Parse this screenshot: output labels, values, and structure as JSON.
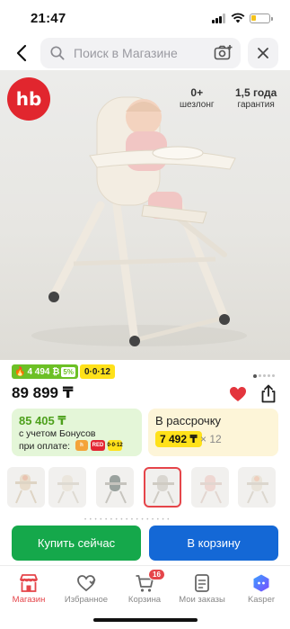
{
  "status_bar": {
    "time": "21:47"
  },
  "search": {
    "placeholder": "Поиск в Магазине"
  },
  "product": {
    "brand_logo": "hb",
    "age_from": "0+",
    "age_from_label": "шезлонг",
    "age_to": "1,5 года",
    "age_to_label": "гарантия",
    "bonus_badge": "4 494 ₿",
    "bonus_badge_pct": "5%",
    "installment_badge": "0·0·12",
    "price": "89 899 ₸",
    "image_count": 5,
    "current_image": 1
  },
  "bonus_card": {
    "amount": "85 405 ₸",
    "line1": "с учетом Бонусов",
    "line2": "при оплате:",
    "icons": [
      "h",
      "RED",
      "0·0·12"
    ]
  },
  "installment_card": {
    "title": "В рассрочку",
    "monthly": "7 492 ₸",
    "multiplier": "× 12"
  },
  "thumbnails": {
    "count": 6,
    "selected_index": 3
  },
  "actions": {
    "buy_now": "Купить сейчас",
    "add_to_cart": "В корзину"
  },
  "tabs": [
    {
      "label": "Магазин",
      "icon": "store-icon",
      "active": true
    },
    {
      "label": "Избранное",
      "icon": "favorites-icon",
      "active": false
    },
    {
      "label": "Корзина",
      "icon": "cart-icon",
      "active": false,
      "badge": "16"
    },
    {
      "label": "Мои заказы",
      "icon": "orders-icon",
      "active": false
    },
    {
      "label": "Kasper",
      "icon": "kasper-icon",
      "active": false
    }
  ],
  "colors": {
    "accent_red": "#e5454a",
    "buy_green": "#15a84b",
    "cart_blue": "#1468d6",
    "installment_yellow": "#ffe11a",
    "bonus_green": "#6cc025"
  }
}
